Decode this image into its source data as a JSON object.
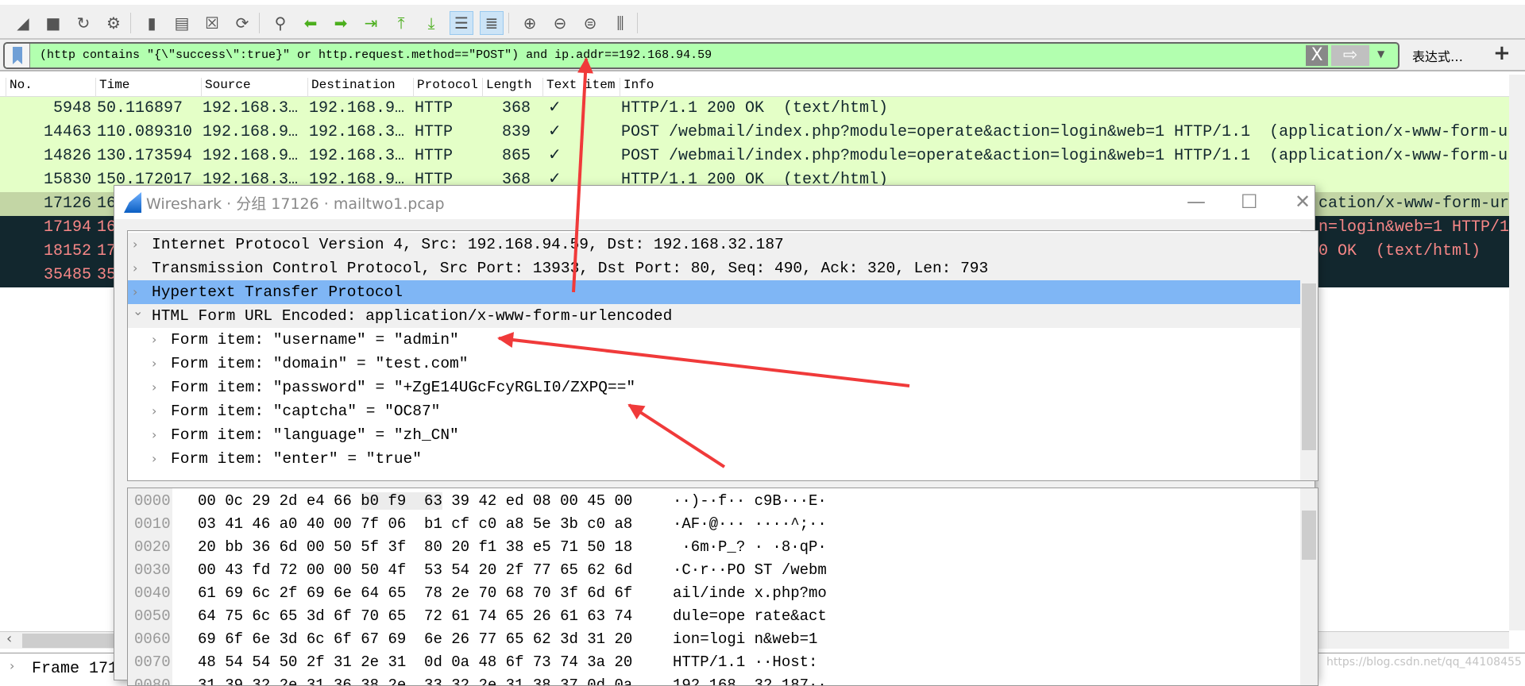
{
  "toolbar": {
    "icons": [
      "shark-fin-start",
      "stop",
      "restart",
      "options-gear",
      "open-folder",
      "file",
      "close-file",
      "reload",
      "find",
      "go-back",
      "go-forward",
      "go-to-packet",
      "first-packet",
      "last-packet",
      "autoscroll",
      "colorize",
      "zoom-in",
      "zoom-out",
      "zoom-normal",
      "resize-columns"
    ]
  },
  "filter": {
    "text": "(http contains \"{\\\"success\\\":true}\" or http.request.method==\"POST\") and ip.addr==192.168.94.59",
    "clear": "X",
    "apply": "⇨",
    "expression": "表达式…",
    "plus": "+",
    "color": "#b2ffaf"
  },
  "columns": [
    "No.",
    "Time",
    "Source",
    "Destination",
    "Protocol",
    "Length",
    "Text item",
    "Info"
  ],
  "packets": [
    {
      "no": "5948",
      "time": "50.116897",
      "src": "192.168.3…",
      "dst": "192.168.9…",
      "proto": "HTTP",
      "len": "368",
      "text": "✓",
      "info": "HTTP/1.1 200 OK  (text/html)"
    },
    {
      "no": "14463",
      "time": "110.089310",
      "src": "192.168.9…",
      "dst": "192.168.3…",
      "proto": "HTTP",
      "len": "839",
      "text": "✓",
      "info": "POST /webmail/index.php?module=operate&action=login&web=1 HTTP/1.1  (application/x-www-form-ur"
    },
    {
      "no": "14826",
      "time": "130.173594",
      "src": "192.168.9…",
      "dst": "192.168.3…",
      "proto": "HTTP",
      "len": "865",
      "text": "✓",
      "info": "POST /webmail/index.php?module=operate&action=login&web=1 HTTP/1.1  (application/x-www-form-ur"
    },
    {
      "no": "15830",
      "time": "150.172017",
      "src": "192.168.3…",
      "dst": "192.168.9…",
      "proto": "HTTP",
      "len": "368",
      "text": "✓",
      "info": "HTTP/1.1 200 OK  (text/html)"
    }
  ],
  "packets_partial": [
    {
      "no": "17126",
      "time": "16",
      "info_tail": "cation/x-www-form-ur"
    },
    {
      "no": "17194",
      "time": "16",
      "info_tail": "n=login&web=1 HTTP/1"
    },
    {
      "no": "18152",
      "time": "17",
      "info_tail": "0 OK  (text/html)"
    },
    {
      "no": "35485",
      "time": "35",
      "info_tail": ""
    }
  ],
  "colors": {
    "http_row": "#e4ffc7",
    "selected_row": "#c3d6a5",
    "bad_row_bg": "#12272e",
    "bad_row_fg": "#f78787",
    "highlight": "#7fb6f5",
    "annotation_arrow": "#f03a3a"
  },
  "frame_pane": {
    "text": "Frame 171"
  },
  "dialog": {
    "title": "Wireshark · 分组 17126 · mailtwo1.pcap",
    "minimize": "—",
    "maximize": "☐",
    "close": "✕",
    "tree": [
      {
        "label": "Internet Protocol Version 4, Src: 192.168.94.59, Dst: 192.168.32.187",
        "expanded": false
      },
      {
        "label": "Transmission Control Protocol, Src Port: 13933, Dst Port: 80, Seq: 490, Ack: 320, Len: 793",
        "expanded": false
      },
      {
        "label": "Hypertext Transfer Protocol",
        "expanded": false,
        "selected": true
      },
      {
        "label": "HTML Form URL Encoded: application/x-www-form-urlencoded",
        "expanded": true
      },
      {
        "label": "Form item: \"username\" = \"admin\"",
        "child": true
      },
      {
        "label": "Form item: \"domain\" = \"test.com\"",
        "child": true
      },
      {
        "label": "Form item: \"password\" = \"+ZgE14UGcFcyRGLI0/ZXPQ==\"",
        "child": true
      },
      {
        "label": "Form item: \"captcha\" = \"OC87\"",
        "child": true
      },
      {
        "label": "Form item: \"language\" = \"zh_CN\"",
        "child": true
      },
      {
        "label": "Form item: \"enter\" = \"true\"",
        "child": true
      }
    ],
    "hex": [
      {
        "off": "0000",
        "pre": "00 0c 29 2d e4 66 ",
        "sel": "b0 f9  63",
        "post": " 39 42 ed 08 00 45 00",
        "ascii": "··)-·f·· c9B···E·"
      },
      {
        "off": "0010",
        "bytes": "03 41 46 a0 40 00 7f 06  b1 cf c0 a8 5e 3b c0 a8",
        "ascii": "·AF·@··· ····^;··"
      },
      {
        "off": "0020",
        "bytes": "20 bb 36 6d 00 50 5f 3f  80 20 f1 38 e5 71 50 18",
        "ascii": " ·6m·P_? · ·8·qP·"
      },
      {
        "off": "0030",
        "bytes": "00 43 fd 72 00 00 50 4f  53 54 20 2f 77 65 62 6d",
        "ascii": "·C·r··PO ST /webm"
      },
      {
        "off": "0040",
        "bytes": "61 69 6c 2f 69 6e 64 65  78 2e 70 68 70 3f 6d 6f",
        "ascii": "ail/inde x.php?mo"
      },
      {
        "off": "0050",
        "bytes": "64 75 6c 65 3d 6f 70 65  72 61 74 65 26 61 63 74",
        "ascii": "dule=ope rate&act"
      },
      {
        "off": "0060",
        "bytes": "69 6f 6e 3d 6c 6f 67 69  6e 26 77 65 62 3d 31 20",
        "ascii": "ion=logi n&web=1 "
      },
      {
        "off": "0070",
        "bytes": "48 54 54 50 2f 31 2e 31  0d 0a 48 6f 73 74 3a 20",
        "ascii": "HTTP/1.1 ··Host: "
      },
      {
        "off": "0080",
        "bytes": "31 39 32 2e 31 36 38 2e  33 32 2e 31 38 37 0d 0a",
        "ascii": "192.168. 32.187··"
      }
    ]
  },
  "watermark": "https://blog.csdn.net/qq_44108455"
}
